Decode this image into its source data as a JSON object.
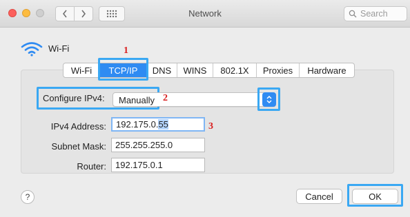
{
  "window": {
    "title": "Network"
  },
  "search": {
    "placeholder": "Search"
  },
  "interface": {
    "name": "Wi-Fi"
  },
  "tabs": [
    {
      "label": "Wi-Fi"
    },
    {
      "label": "TCP/IP"
    },
    {
      "label": "DNS"
    },
    {
      "label": "WINS"
    },
    {
      "label": "802.1X"
    },
    {
      "label": "Proxies"
    },
    {
      "label": "Hardware"
    }
  ],
  "selected_tab": "TCP/IP",
  "configure": {
    "label": "Configure IPv4:",
    "value": "Manually"
  },
  "fields": {
    "ipv4": {
      "label": "IPv4 Address:",
      "value_prefix": "192.175.0.",
      "value_selected": "55"
    },
    "subnet": {
      "label": "Subnet Mask:",
      "value": "255.255.255.0"
    },
    "router": {
      "label": "Router:",
      "value": "192.175.0.1"
    }
  },
  "annotations": {
    "step1": "1",
    "step2": "2",
    "step3": "3"
  },
  "buttons": {
    "help": "?",
    "cancel": "Cancel",
    "ok": "OK"
  },
  "colors": {
    "accent": "#2f8bf2",
    "highlight": "#3aa8f3",
    "annotation": "#d91e1e"
  }
}
